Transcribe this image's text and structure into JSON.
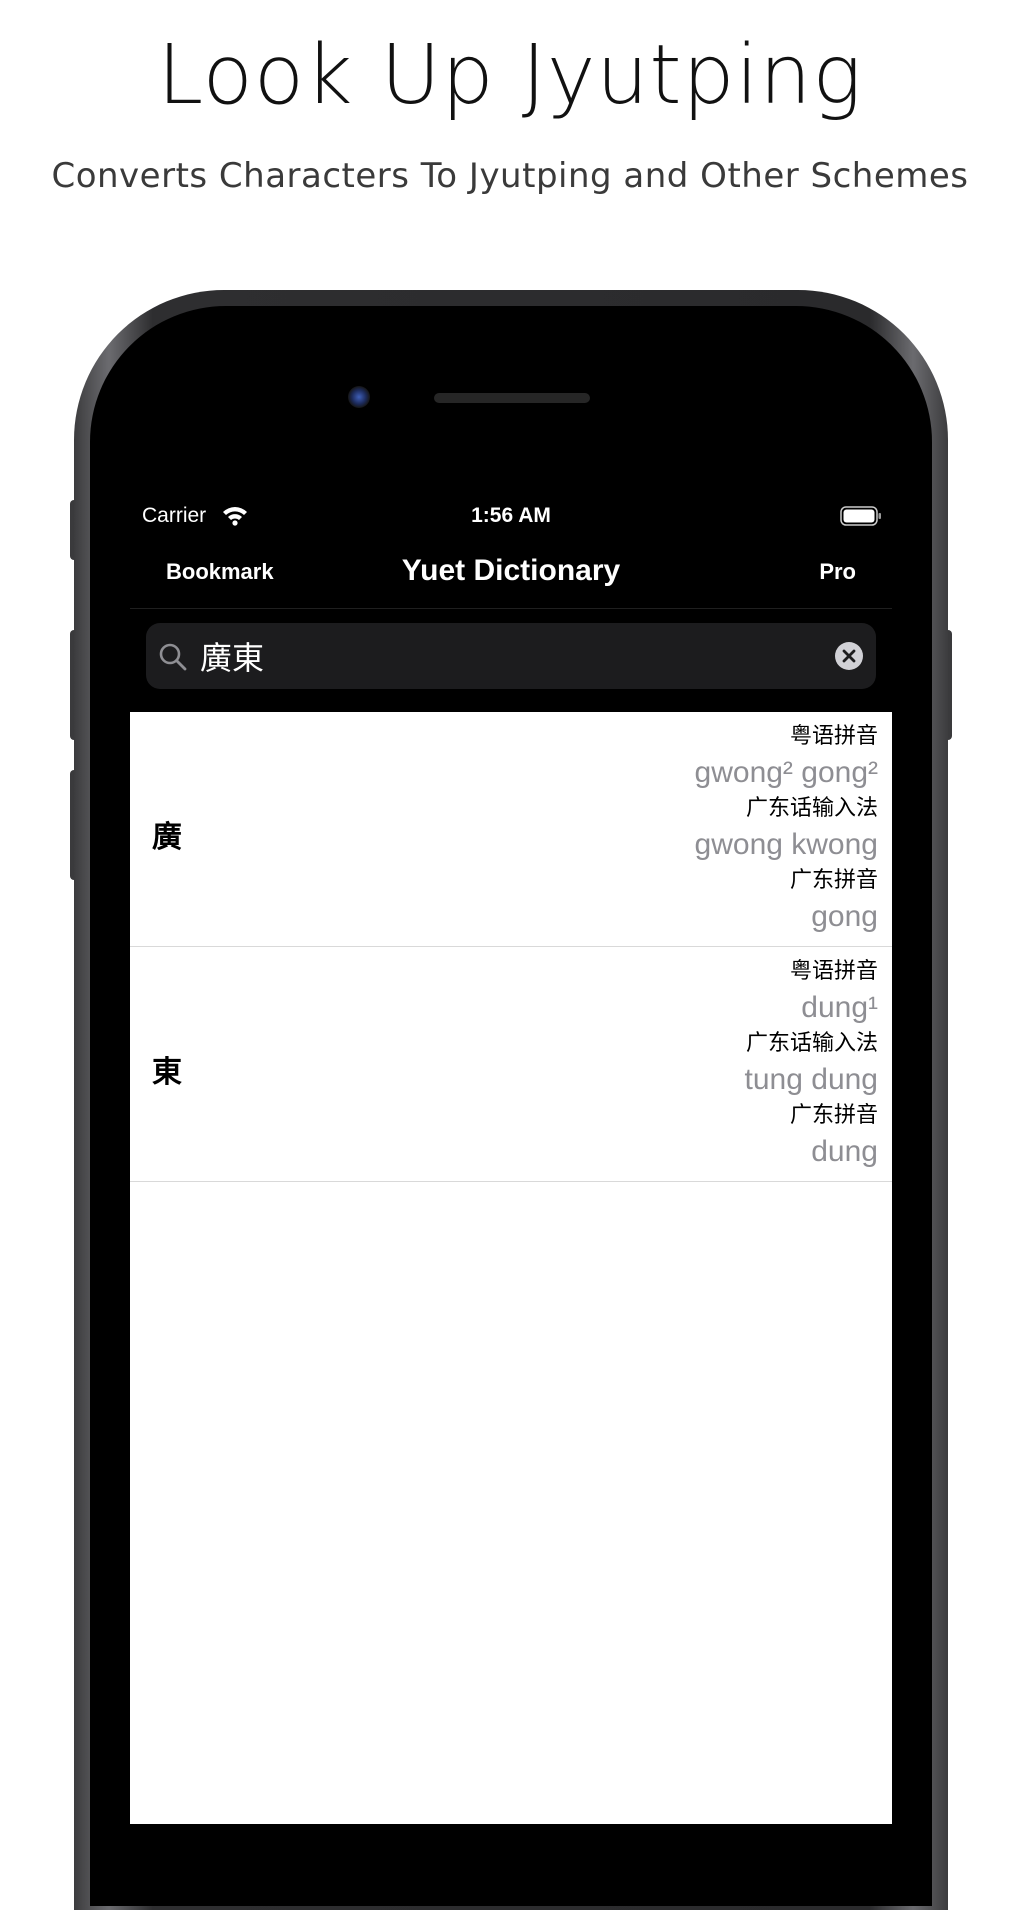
{
  "promo": {
    "title": "Look Up Jyutping",
    "subtitle": "Converts Characters To Jyutping and Other Schemes"
  },
  "status_bar": {
    "carrier": "Carrier",
    "time": "1:56 AM",
    "icons": [
      "wifi-icon",
      "battery-icon"
    ]
  },
  "nav": {
    "left_label": "Bookmark",
    "title": "Yuet Dictionary",
    "right_label": "Pro"
  },
  "search": {
    "value": "廣東",
    "icons": [
      "search-icon",
      "clear-icon"
    ]
  },
  "results": [
    {
      "character": "廣",
      "readings": [
        {
          "label": "粤语拼音",
          "value": "gwong² gong²"
        },
        {
          "label": "广东话输入法",
          "value": "gwong kwong"
        },
        {
          "label": "广东拼音",
          "value": "gong"
        }
      ]
    },
    {
      "character": "東",
      "readings": [
        {
          "label": "粤语拼音",
          "value": "dung¹"
        },
        {
          "label": "广东话输入法",
          "value": "tung dung"
        },
        {
          "label": "广东拼音",
          "value": "dung"
        }
      ]
    }
  ],
  "colors": {
    "screen_background": "#000000",
    "list_background": "#ffffff",
    "reading_value": "#8e8e93",
    "search_field": "#1c1c1e"
  }
}
